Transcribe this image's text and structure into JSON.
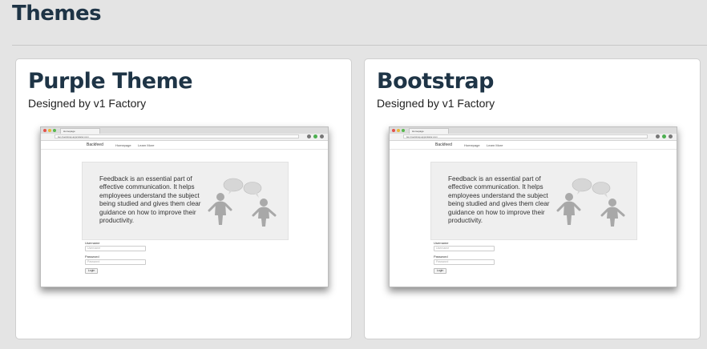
{
  "page": {
    "title": "Themes"
  },
  "themes": [
    {
      "name": "Purple Theme",
      "designer": "Designed by v1 Factory",
      "preview": {
        "tab_title": "Homepage",
        "url": "iter-bootstrap.appculator.com",
        "brand": "Backfeed",
        "nav_links": [
          "Homepage",
          "Learn More"
        ],
        "hero_text": "Feedback is an essential part of effective communication. It helps employees understand the subject being studied and gives them clear guidance on how to improve their productivity.",
        "username_label": "Username",
        "username_placeholder": "Username",
        "password_label": "Password",
        "password_placeholder": "Password",
        "login_label": "Login"
      }
    },
    {
      "name": "Bootstrap",
      "designer": "Designed by v1 Factory",
      "preview": {
        "tab_title": "Homepage",
        "url": "iter-bootstrap.appculator.com",
        "brand": "Backfeed",
        "nav_links": [
          "Homepage",
          "Learn More"
        ],
        "hero_text": "Feedback is an essential part of effective communication. It helps employees understand the subject being studied and gives them clear guidance on how to improve their productivity.",
        "username_label": "Username",
        "username_placeholder": "Username",
        "password_label": "Password",
        "password_placeholder": "Password",
        "login_label": "Login"
      }
    }
  ],
  "colors": {
    "heading": "#1e3446",
    "page_bg": "#e4e4e4",
    "card_bg": "#ffffff"
  },
  "icons": {
    "window_close": "red-dot-icon",
    "window_minimize": "yellow-dot-icon",
    "window_maximize": "green-dot-icon",
    "illustration": "speech-bubbles-figures-icon"
  }
}
